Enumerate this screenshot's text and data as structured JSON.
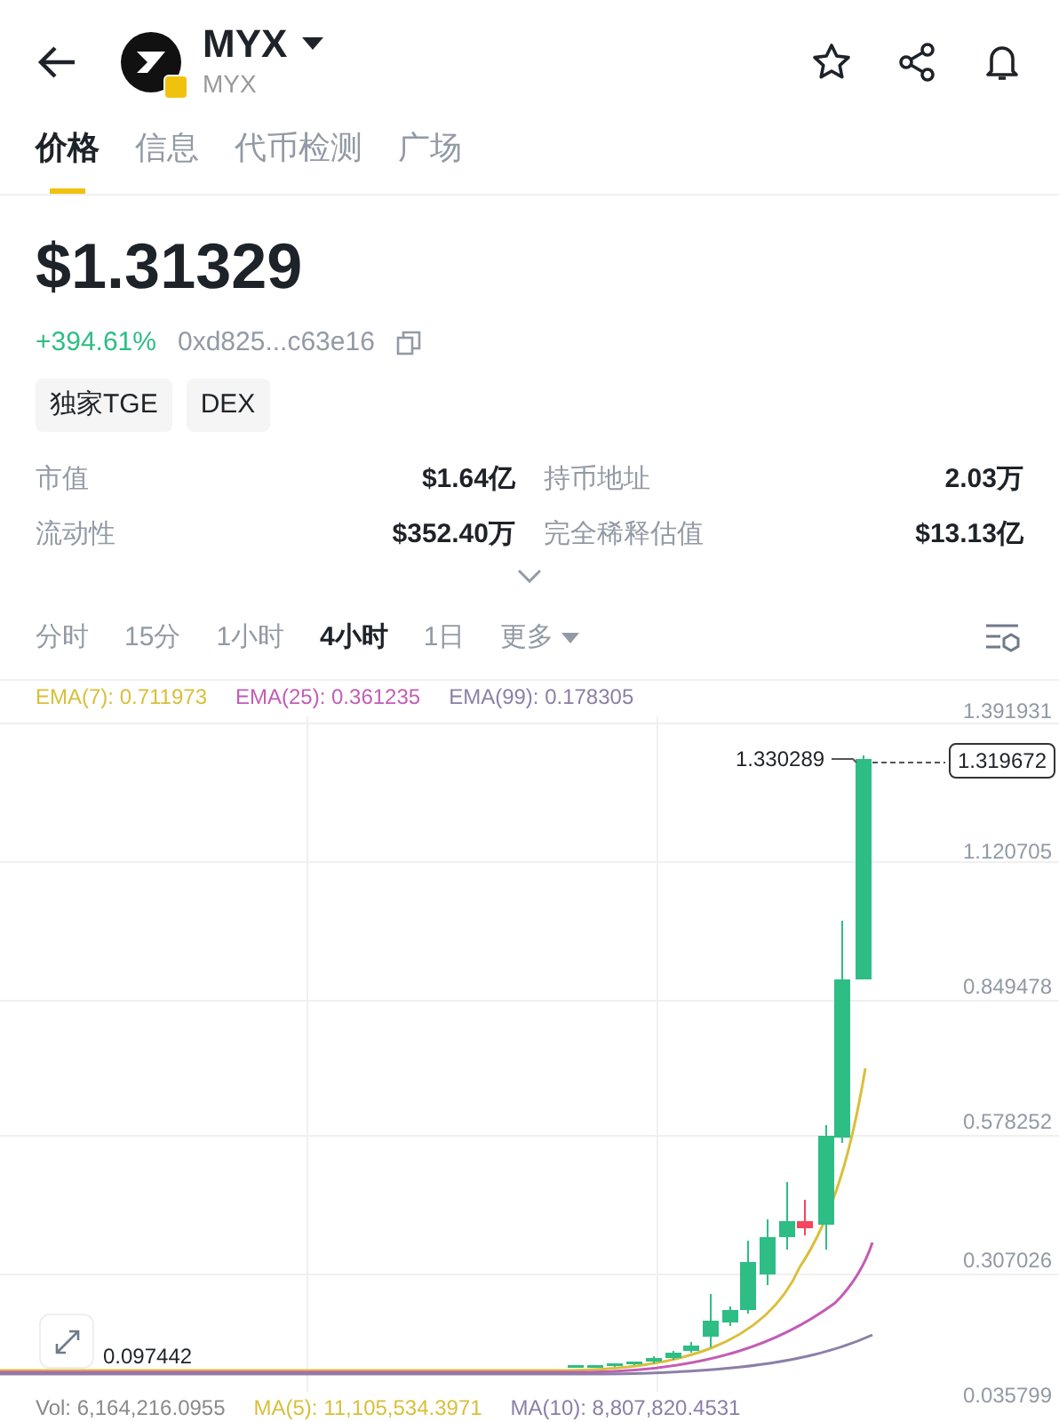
{
  "header": {
    "symbol": "MYX",
    "subtitle": "MYX"
  },
  "tabs": [
    {
      "label": "价格",
      "selected": true
    },
    {
      "label": "信息",
      "selected": false
    },
    {
      "label": "代币检测",
      "selected": false
    },
    {
      "label": "广场",
      "selected": false
    }
  ],
  "price": "$1.31329",
  "change": "+394.61%",
  "contract": "0xd825...c63e16",
  "tags": [
    "独家TGE",
    "DEX"
  ],
  "stats": [
    {
      "label": "市值",
      "value": "$1.64亿"
    },
    {
      "label": "持币地址",
      "value": "2.03万"
    },
    {
      "label": "流动性",
      "value": "$352.40万"
    },
    {
      "label": "完全稀释估值",
      "value": "$13.13亿"
    }
  ],
  "intervals": [
    {
      "label": "分时",
      "selected": false,
      "kind": "option"
    },
    {
      "label": "15分",
      "selected": false,
      "kind": "option"
    },
    {
      "label": "1小时",
      "selected": false,
      "kind": "option"
    },
    {
      "label": "4小时",
      "selected": true,
      "kind": "option"
    },
    {
      "label": "1日",
      "selected": false,
      "kind": "option"
    },
    {
      "label": "更多",
      "selected": false,
      "kind": "menu"
    }
  ],
  "chart": {
    "legend": [
      {
        "label": "EMA(7): 0.711973",
        "color": "#d9bf3a"
      },
      {
        "label": "EMA(25): 0.361235",
        "color": "#c35db5"
      },
      {
        "label": "EMA(99): 0.178305",
        "color": "#8c7fa6"
      }
    ],
    "y_labels": [
      "1.391931",
      "1.120705",
      "0.849478",
      "0.578252",
      "0.307026",
      "0.035799"
    ],
    "high_label": "1.330289",
    "low_label": "0.097442",
    "last_price": "1.319672",
    "volume_legend": [
      {
        "label": "Vol: 6,164,216.0955",
        "color": "#8a8a8a"
      },
      {
        "label": "MA(5): 11,105,534.3971",
        "color": "#d9bf3a"
      },
      {
        "label": "MA(10): 8,807,820.4531",
        "color": "#8c7fa6"
      }
    ]
  }
}
